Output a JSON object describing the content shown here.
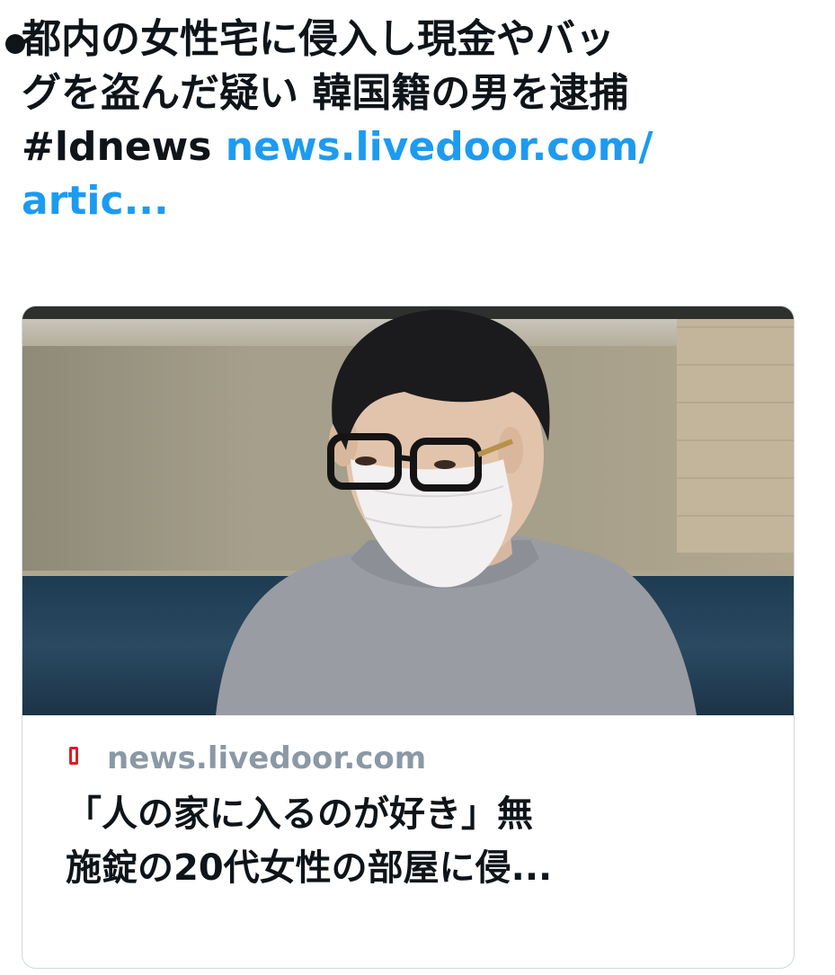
{
  "tweet": {
    "text_line1": "都内の女性宅に侵入し現金やバッ",
    "text_line2": "グを盗んだ疑い 韓国籍の男を逮捕",
    "hashtag": "#ldnews",
    "link_part1": "news.livedoor.com/",
    "link_part2": "artic..."
  },
  "card": {
    "image_icon": "person-photo",
    "domain": "news.livedoor.com",
    "favicon": "livedoor-favicon",
    "title_line1": "「人の家に入るのが好き」無",
    "title_line2": "施錠の20代女性の部屋に侵..."
  },
  "colors": {
    "link": "#1d9bf0",
    "favicon": "#d81f26",
    "domain_text": "#8b98a5"
  }
}
